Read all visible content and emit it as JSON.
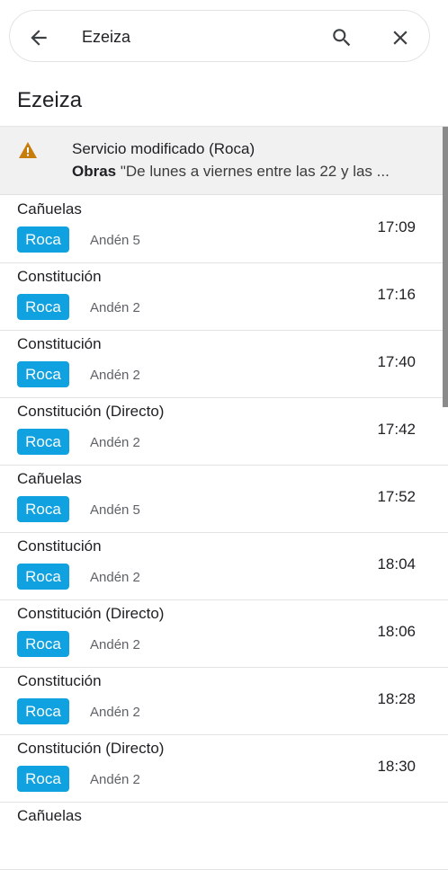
{
  "search": {
    "value": "Ezeiza"
  },
  "station": {
    "title": "Ezeiza"
  },
  "alert": {
    "title": "Servicio modificado (Roca)",
    "label": "Obras",
    "detail": " \"De lunes a viernes entre las 22 y las ..."
  },
  "departures": [
    {
      "destination": "Cañuelas",
      "line": "Roca",
      "platform": "Andén 5",
      "time": "17:09"
    },
    {
      "destination": "Constitución",
      "line": "Roca",
      "platform": "Andén 2",
      "time": "17:16"
    },
    {
      "destination": "Constitución",
      "line": "Roca",
      "platform": "Andén 2",
      "time": "17:40"
    },
    {
      "destination": "Constitución (Directo)",
      "line": "Roca",
      "platform": "Andén 2",
      "time": "17:42"
    },
    {
      "destination": "Cañuelas",
      "line": "Roca",
      "platform": "Andén 5",
      "time": "17:52"
    },
    {
      "destination": "Constitución",
      "line": "Roca",
      "platform": "Andén 2",
      "time": "18:04"
    },
    {
      "destination": "Constitución (Directo)",
      "line": "Roca",
      "platform": "Andén 2",
      "time": "18:06"
    },
    {
      "destination": "Constitución",
      "line": "Roca",
      "platform": "Andén 2",
      "time": "18:28"
    },
    {
      "destination": "Constitución (Directo)",
      "line": "Roca",
      "platform": "Andén 2",
      "time": "18:30"
    },
    {
      "destination": "Cañuelas"
    }
  ],
  "colors": {
    "line_roca": "#0fa1e0",
    "alert_icon": "#c77c0e"
  },
  "icons": {
    "back": "arrow-back-icon",
    "search": "search-icon",
    "clear": "close-icon",
    "alert": "warning-icon"
  }
}
